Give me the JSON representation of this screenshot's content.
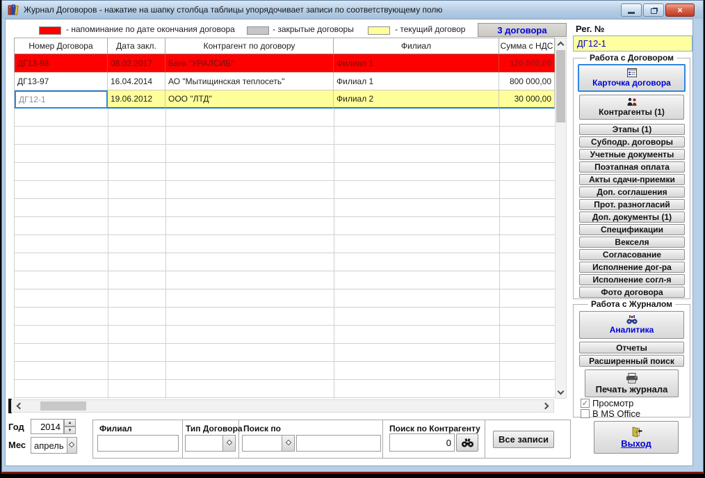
{
  "window": {
    "title": "Журнал Договоров - нажатие на шапку столбца таблицы упорядочивает записи по соответствующему полю",
    "close_glyph": "×"
  },
  "legend": {
    "items": [
      {
        "label": "- напоминание по дате окончания договора",
        "color": "#fe0000"
      },
      {
        "label": "- закрытые договоры",
        "color": "#c6c6c6"
      },
      {
        "label": "- текущий договор",
        "color": "#ffff99"
      }
    ],
    "count_label": "3 договора"
  },
  "reg": {
    "label": "Рег. №",
    "value": "ДГ12-1"
  },
  "table": {
    "columns": [
      "Номер Договора",
      "Дата закл.",
      "Контрагент по договору",
      "Филиал",
      "Сумма с НДС"
    ],
    "rows": [
      {
        "number": "ДГ13-98",
        "date": "08.02.2017",
        "contractor": "Банк \"УРАЛСИБ\"",
        "branch": "Филиал 1",
        "sum": "120 000,00"
      },
      {
        "number": "ДГ13-97",
        "date": "16.04.2014",
        "contractor": "АО \"Мытищинская теплосеть\"",
        "branch": "Филиал 1",
        "sum": "800 000,00"
      },
      {
        "number": "ДГ12-1",
        "date": "19.06.2012",
        "contractor": "ООО \"ЛТД\"",
        "branch": "Филиал 2",
        "sum": "30 000,00"
      }
    ]
  },
  "contract_panel": {
    "title": "Работа с Договором",
    "card_button": "Карточка договора",
    "contractors_button": "Контрагенты (1)",
    "buttons": [
      "Этапы (1)",
      "Субподр. договоры",
      "Учетные документы",
      "Поэтапная оплата",
      "Акты сдачи-приемки",
      "Доп. соглашения",
      "Прот. разногласий",
      "Доп. документы (1)",
      "Спецификации",
      "Векселя",
      "Согласование",
      "Исполнение дог-ра",
      "Исполнение согл-я",
      "Фото договора"
    ]
  },
  "journal_panel": {
    "title": "Работа с Журналом",
    "analytics_button": "Аналитика",
    "reports_button": "Отчеты",
    "adv_search_button": "Расширенный поиск",
    "print_button": "Печать журнала",
    "preview_checkbox": {
      "label": "Просмотр",
      "checked": true,
      "check_glyph": "✓"
    },
    "msoffice_checkbox": {
      "label": "В MS Office",
      "checked": false
    }
  },
  "filters": {
    "year": {
      "label": "Год",
      "value": "2014",
      "up_glyph": "▲",
      "down_glyph": "▼"
    },
    "month": {
      "label": "Мес",
      "value": "апрель"
    },
    "branch_label": "Филиал",
    "type_label": "Тип Договора",
    "search_by_label": "Поиск по",
    "contractor_search": {
      "label": "Поиск по Контрагенту",
      "value": "0"
    },
    "all_records_button": "Все записи"
  },
  "exit_button": "Выход"
}
